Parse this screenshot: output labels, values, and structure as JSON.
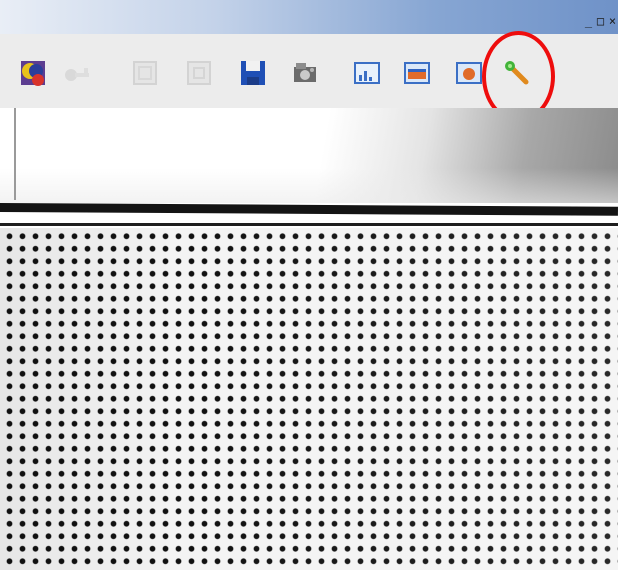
{
  "window": {
    "controls": {
      "minimize": "_",
      "maximize": "□",
      "close": "×"
    }
  },
  "toolbar": {
    "buttons": [
      {
        "name": "color-palette-icon",
        "enabled": true
      },
      {
        "name": "key-icon",
        "enabled": false
      },
      {
        "name": "frame-icon",
        "enabled": false
      },
      {
        "name": "frame-alt-icon",
        "enabled": false
      },
      {
        "name": "save-icon",
        "enabled": true
      },
      {
        "name": "camera-film-icon",
        "enabled": true
      },
      {
        "name": "histogram-icon",
        "enabled": true
      },
      {
        "name": "image-view-icon",
        "enabled": true
      },
      {
        "name": "image-zoom-icon",
        "enabled": true
      },
      {
        "name": "magic-wand-icon",
        "enabled": true,
        "highlighted": true
      }
    ]
  },
  "colors": {
    "highlight_ring": "#ee0d0d",
    "save_blue": "#1f4fb5"
  }
}
